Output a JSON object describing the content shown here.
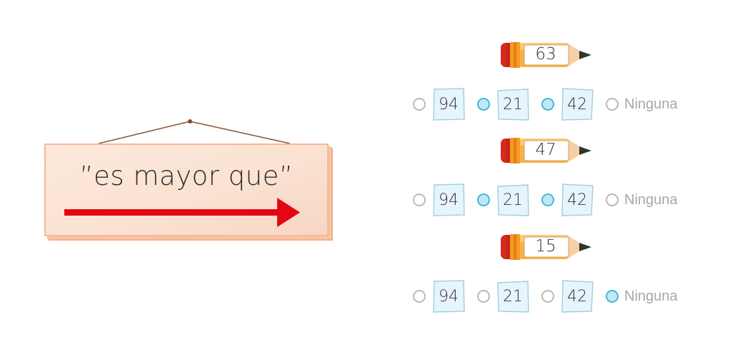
{
  "sign": {
    "text": "”es mayor que”"
  },
  "colors": {
    "arrow": "#e30613",
    "radio_highlight": "#45b7d6",
    "pencil_body": "#f6a623"
  },
  "questions": [
    {
      "target": "63",
      "options": [
        "94",
        "21",
        "42"
      ],
      "none_label": "Ninguna",
      "highlighted": [
        false,
        true,
        true,
        false
      ]
    },
    {
      "target": "47",
      "options": [
        "94",
        "21",
        "42"
      ],
      "none_label": "Ninguna",
      "highlighted": [
        false,
        true,
        true,
        false
      ]
    },
    {
      "target": "15",
      "options": [
        "94",
        "21",
        "42"
      ],
      "none_label": "Ninguna",
      "highlighted": [
        false,
        false,
        false,
        true
      ]
    }
  ]
}
